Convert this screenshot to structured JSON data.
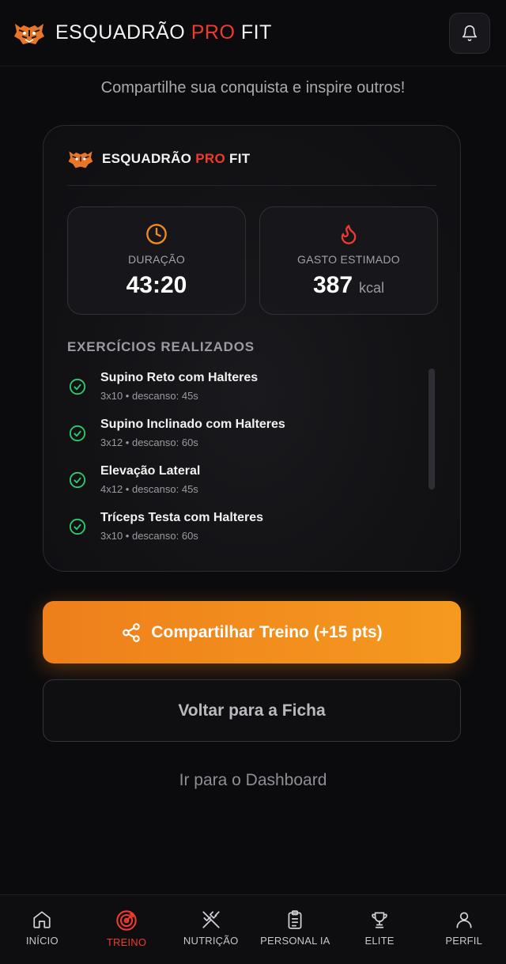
{
  "header": {
    "brand_a": "ESQUADRÃO",
    "brand_pro": "PRO",
    "brand_b": "FIT",
    "logo_icon": "tiger-logo-icon",
    "bell_icon": "bell-icon"
  },
  "subtitle": "Compartilhe sua conquista e inspire outros!",
  "card": {
    "brand_a": "ESQUADRÃO",
    "brand_pro": "PRO",
    "brand_b": "FIT",
    "duration": {
      "label": "DURAÇÃO",
      "value": "43:20",
      "icon": "clock-icon"
    },
    "calories": {
      "label": "GASTO ESTIMADO",
      "value": "387",
      "unit": "kcal",
      "icon": "flame-icon"
    },
    "section_title": "EXERCÍCIOS REALIZADOS",
    "exercises": [
      {
        "name": "Supino Reto com Halteres",
        "meta": "3x10 • descanso: 45s"
      },
      {
        "name": "Supino Inclinado com Halteres",
        "meta": "3x12 • descanso: 60s"
      },
      {
        "name": "Elevação Lateral",
        "meta": "4x12 • descanso: 45s"
      },
      {
        "name": "Tríceps Testa com Halteres",
        "meta": "3x10 • descanso: 60s"
      }
    ]
  },
  "actions": {
    "share_label": "Compartilhar Treino (+15 pts)",
    "back_label": "Voltar para a Ficha",
    "dashboard_label": "Ir para o Dashboard"
  },
  "nav": {
    "items": [
      {
        "label": "INÍCIO",
        "icon": "home-icon"
      },
      {
        "label": "TREINO",
        "icon": "target-icon",
        "active": true
      },
      {
        "label": "NUTRIÇÃO",
        "icon": "utensils-icon"
      },
      {
        "label": "PERSONAL IA",
        "icon": "clipboard-icon"
      },
      {
        "label": "ELITE",
        "icon": "trophy-icon"
      },
      {
        "label": "PERFIL",
        "icon": "user-icon"
      }
    ]
  },
  "colors": {
    "accent_red": "#ef3b2d",
    "accent_orange": "#f59a1f",
    "check_green": "#2ecc71",
    "background": "#0b0b0d"
  }
}
